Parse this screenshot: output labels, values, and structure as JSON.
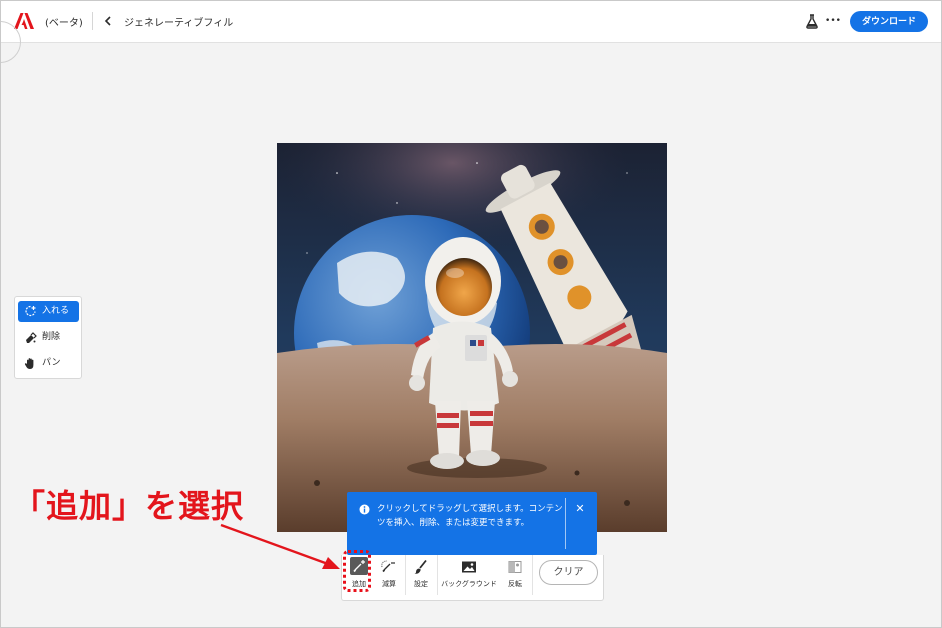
{
  "header": {
    "app_name": "(ベータ)",
    "page_title": "ジェネレーティブフィル",
    "download_label": "ダウンロード",
    "more_label": "•••"
  },
  "tool_panel": {
    "items": [
      {
        "label": "入れる",
        "icon": "lasso-plus-icon",
        "active": true
      },
      {
        "label": "削除",
        "icon": "eraser-icon",
        "active": false
      },
      {
        "label": "パン",
        "icon": "hand-icon",
        "active": false
      }
    ]
  },
  "tooltip": {
    "text": "クリックしてドラッグして選択します。コンテンツを挿入、削除、または変更できます。",
    "close": "✕"
  },
  "toolbar": {
    "add_label": "追加",
    "subtract_label": "減算",
    "settings_label": "設定",
    "background_label": "バックグラウンド",
    "invert_label": "反転",
    "clear_label": "クリア"
  },
  "annotation": {
    "text": "「追加」を選択"
  },
  "colors": {
    "accent": "#1473e6",
    "annotation_red": "#e3151c"
  }
}
